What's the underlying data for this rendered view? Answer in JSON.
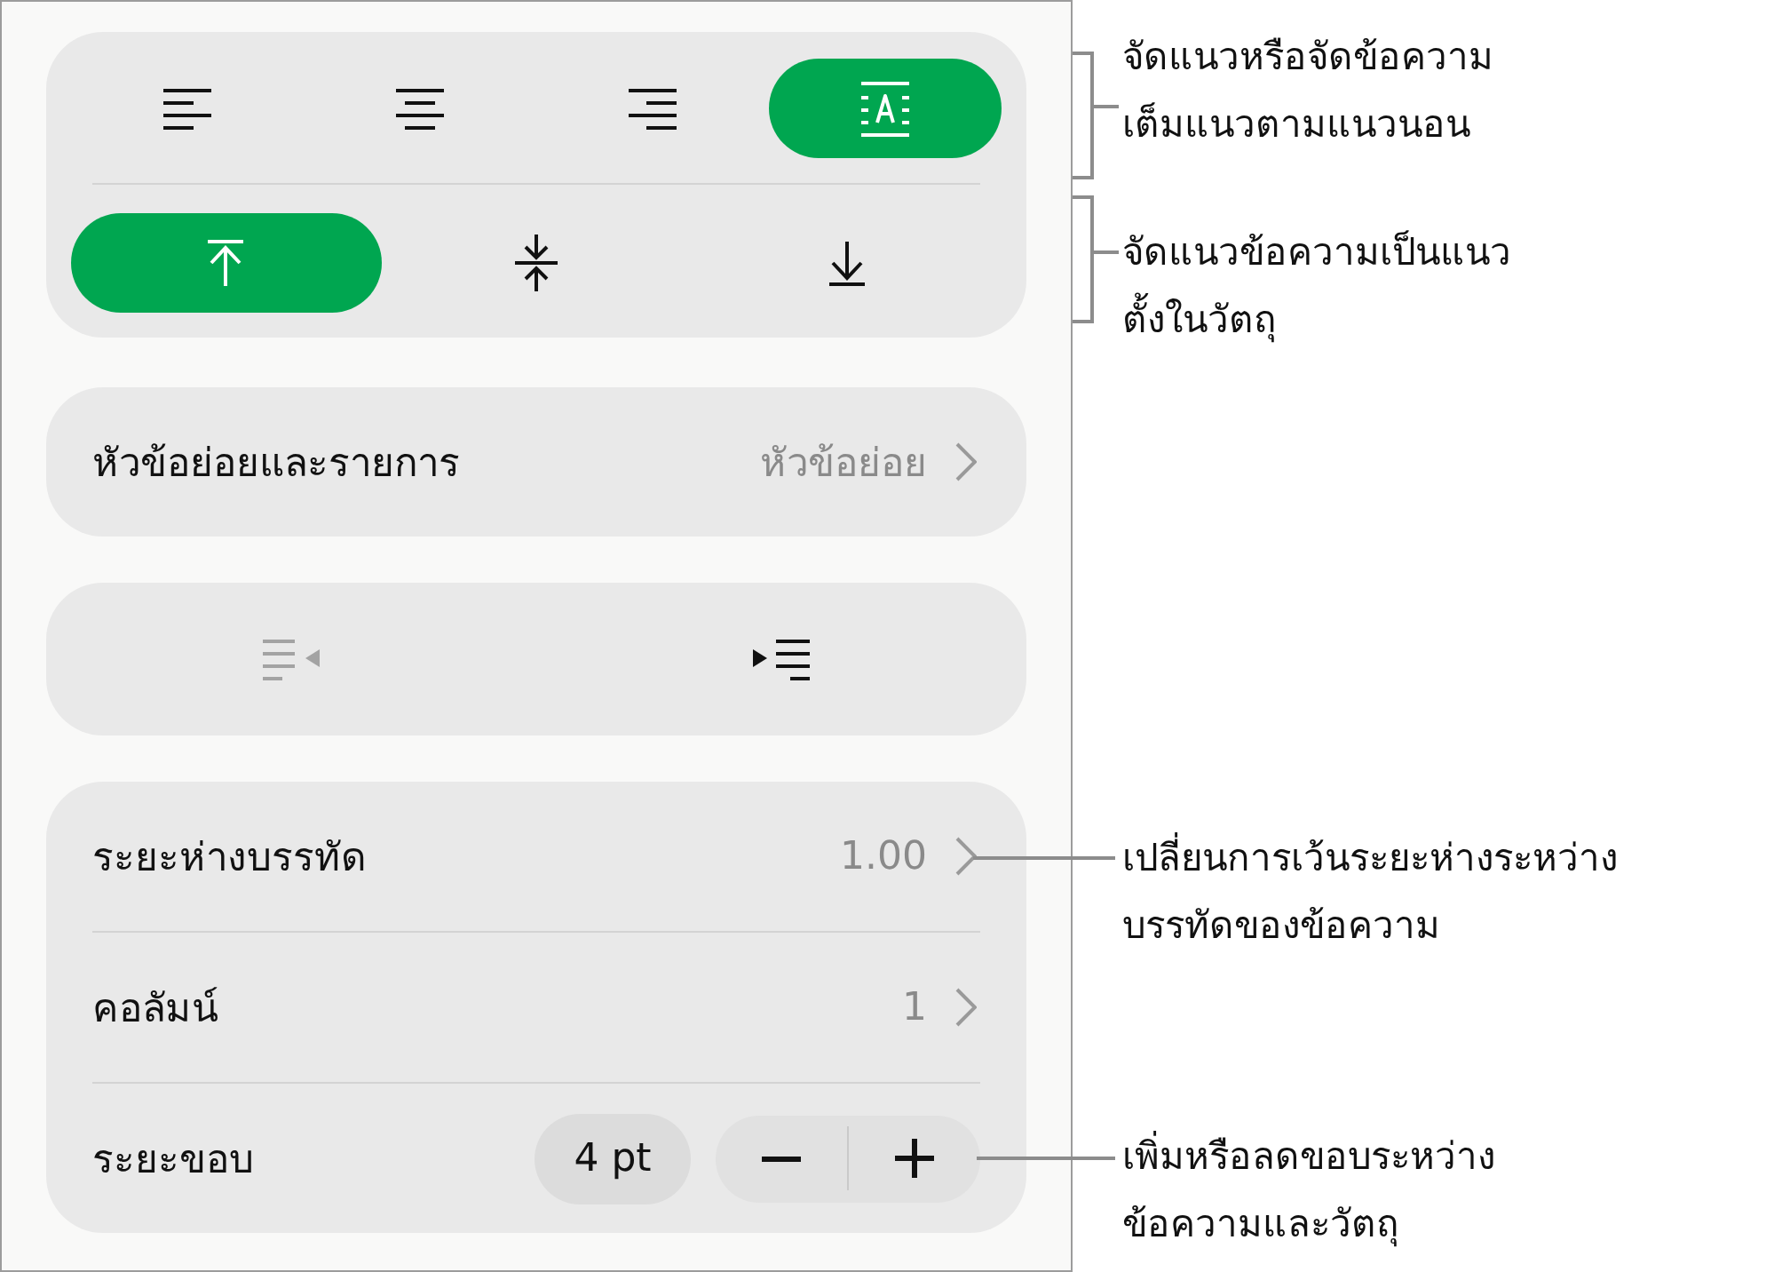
{
  "horizontal_alignment": [
    {
      "kind": "left",
      "selected": false
    },
    {
      "kind": "center",
      "selected": false
    },
    {
      "kind": "right",
      "selected": false
    },
    {
      "kind": "justify",
      "selected": true
    }
  ],
  "vertical_alignment": [
    {
      "kind": "top",
      "selected": true
    },
    {
      "kind": "middle",
      "selected": false
    },
    {
      "kind": "bottom",
      "selected": false
    }
  ],
  "list_row": {
    "label": "หัวข้อย่อยและรายการ",
    "value": "หัวข้อย่อย"
  },
  "indent_buttons": [
    {
      "kind": "outdent",
      "disabled": true
    },
    {
      "kind": "indent",
      "disabled": false
    }
  ],
  "spacing_rows": [
    {
      "kind": "disclosure",
      "label": "ระยะห่างบรรทัด",
      "value": "1.00"
    },
    {
      "kind": "disclosure",
      "label": "คอลัมน์",
      "value": "1"
    },
    {
      "kind": "stepper",
      "label": "ระยะขอบ",
      "value": "4 pt"
    }
  ],
  "callouts": [
    {
      "kind": "bracket",
      "lines": [
        "จัดแนวหรือจัดข้อความ",
        "เต็มแนวตามแนวนอน"
      ]
    },
    {
      "kind": "bracket",
      "lines": [
        "จัดแนวข้อความเป็นแนว",
        "ตั้งในวัตถุ"
      ]
    },
    {
      "kind": "leader",
      "lines": [
        "เปลี่ยนการเว้นระยะห่างระหว่าง",
        "บรรทัดของข้อความ"
      ]
    },
    {
      "kind": "leader",
      "lines": [
        "เพิ่มหรือลดขอบระหว่าง",
        "ข้อความและวัตถุ"
      ]
    }
  ]
}
